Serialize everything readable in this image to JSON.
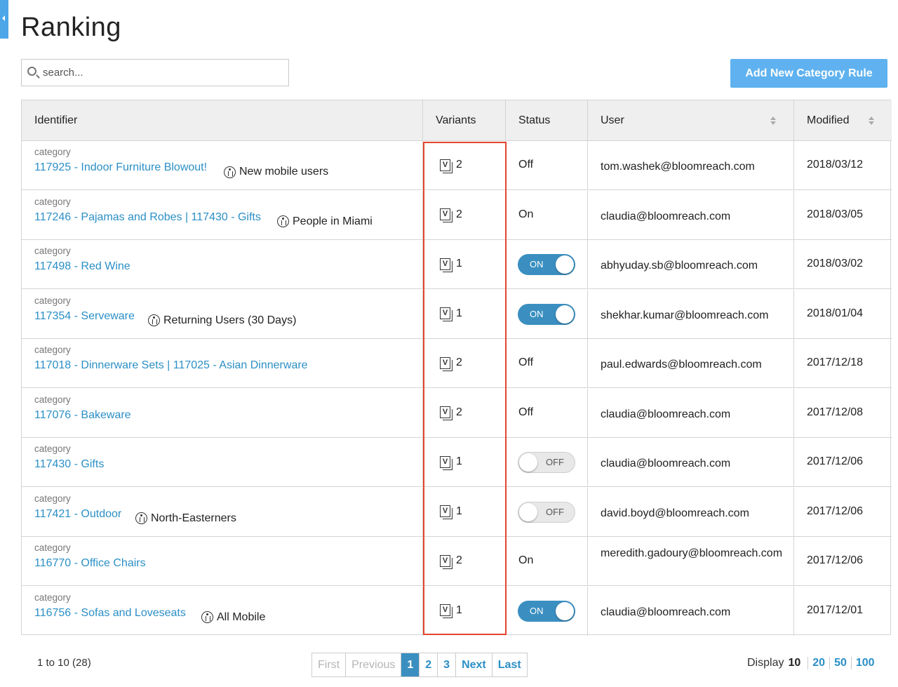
{
  "page": {
    "title": "Ranking"
  },
  "search": {
    "placeholder": "search..."
  },
  "actions": {
    "add_rule_label": "Add New Category Rule"
  },
  "columns": {
    "identifier": "Identifier",
    "variants": "Variants",
    "status": "Status",
    "user": "User",
    "modified": "Modified"
  },
  "rows": [
    {
      "kind": "category",
      "identifier": "117925 - Indoor Furniture Blowout!",
      "segment": "New mobile users",
      "variants": "2",
      "status_type": "text",
      "status": "Off",
      "user": "tom.washek@bloomreach.com",
      "modified": "2018/03/12"
    },
    {
      "kind": "category",
      "identifier": "117246 - Pajamas and Robes | 117430 - Gifts",
      "segment": "People in Miami",
      "variants": "2",
      "status_type": "text",
      "status": "On",
      "user": "claudia@bloomreach.com",
      "modified": "2018/03/05"
    },
    {
      "kind": "category",
      "identifier": "117498 - Red Wine",
      "segment": "",
      "variants": "1",
      "status_type": "toggle",
      "status": "ON",
      "user": "abhyuday.sb@bloomreach.com",
      "modified": "2018/03/02"
    },
    {
      "kind": "category",
      "identifier": "117354 - Serveware",
      "segment": "Returning Users (30 Days)",
      "variants": "1",
      "status_type": "toggle",
      "status": "ON",
      "user": "shekhar.kumar@bloomreach.com",
      "modified": "2018/01/04"
    },
    {
      "kind": "category",
      "identifier": "117018 - Dinnerware Sets | 117025 - Asian Dinnerware",
      "segment": "",
      "variants": "2",
      "status_type": "text",
      "status": "Off",
      "user": "paul.edwards@bloomreach.com",
      "modified": "2017/12/18"
    },
    {
      "kind": "category",
      "identifier": "117076 - Bakeware",
      "segment": "",
      "variants": "2",
      "status_type": "text",
      "status": "Off",
      "user": "claudia@bloomreach.com",
      "modified": "2017/12/08"
    },
    {
      "kind": "category",
      "identifier": "117430 - Gifts",
      "segment": "",
      "variants": "1",
      "status_type": "toggle",
      "status": "OFF",
      "user": "claudia@bloomreach.com",
      "modified": "2017/12/06"
    },
    {
      "kind": "category",
      "identifier": "117421 - Outdoor",
      "segment": "North-Easterners",
      "variants": "1",
      "status_type": "toggle",
      "status": "OFF",
      "user": "david.boyd@bloomreach.com",
      "modified": "2017/12/06"
    },
    {
      "kind": "category",
      "identifier": "116770 - Office Chairs",
      "segment": "",
      "variants": "2",
      "status_type": "text",
      "status": "On",
      "user": "meredith.gadoury@bloomreach.com",
      "modified": "2017/12/06"
    },
    {
      "kind": "category",
      "identifier": "116756 - Sofas and Loveseats",
      "segment": "All Mobile",
      "variants": "1",
      "status_type": "toggle",
      "status": "ON",
      "user": "claudia@bloomreach.com",
      "modified": "2017/12/01"
    }
  ],
  "footer": {
    "range": "1 to 10 (28)",
    "pager": {
      "first": "First",
      "previous": "Previous",
      "pages": [
        "1",
        "2",
        "3"
      ],
      "current": "1",
      "next": "Next",
      "last": "Last"
    },
    "display_label": "Display",
    "display_current": "10",
    "display_options": [
      "20",
      "50",
      "100"
    ]
  },
  "colors": {
    "accent": "#3a8fc0",
    "link": "#2b8fc6",
    "button": "#5fb2ef",
    "highlight": "#e2462c"
  }
}
